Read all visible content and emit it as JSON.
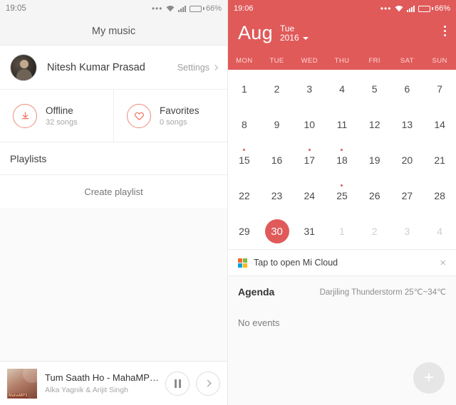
{
  "left": {
    "status": {
      "time": "19:05",
      "battery": "66%",
      "overflow_icon": "more-dots-icon",
      "wifi_icon": "wifi-icon",
      "signal_icon": "signal-icon"
    },
    "title": "My music",
    "profile": {
      "name": "Nitesh Kumar Prasad",
      "settings_label": "Settings",
      "avatar_name": "user-avatar"
    },
    "quick_items": [
      {
        "icon": "download-icon",
        "title": "Offline",
        "subtitle": "32 songs"
      },
      {
        "icon": "heart-icon",
        "title": "Favorites",
        "subtitle": "0 songs"
      }
    ],
    "playlists_header": "Playlists",
    "create_playlist": "Create playlist",
    "player": {
      "track_title": "Tum Saath Ho - MahaMP3...",
      "artist": "Alka Yagnik & Arijit Singh",
      "album_badge": "MahaMP3",
      "pause_label": "Pause",
      "next_label": "Next"
    }
  },
  "right": {
    "status": {
      "time": "19:06",
      "battery": "66%"
    },
    "header": {
      "month": "Aug",
      "weekday": "Tue",
      "year": "2016",
      "menu_label": "More options"
    },
    "weekdays": [
      "MON",
      "TUE",
      "WED",
      "THU",
      "FRI",
      "SAT",
      "SUN"
    ],
    "days": [
      {
        "n": "1"
      },
      {
        "n": "2"
      },
      {
        "n": "3"
      },
      {
        "n": "4"
      },
      {
        "n": "5"
      },
      {
        "n": "6"
      },
      {
        "n": "7"
      },
      {
        "n": "8"
      },
      {
        "n": "9"
      },
      {
        "n": "10"
      },
      {
        "n": "11"
      },
      {
        "n": "12"
      },
      {
        "n": "13"
      },
      {
        "n": "14"
      },
      {
        "n": "15",
        "dot": true
      },
      {
        "n": "16"
      },
      {
        "n": "17",
        "dot": true
      },
      {
        "n": "18",
        "dot": true
      },
      {
        "n": "19"
      },
      {
        "n": "20"
      },
      {
        "n": "21"
      },
      {
        "n": "22"
      },
      {
        "n": "23"
      },
      {
        "n": "24"
      },
      {
        "n": "25",
        "dot": true
      },
      {
        "n": "26"
      },
      {
        "n": "27"
      },
      {
        "n": "28"
      },
      {
        "n": "29"
      },
      {
        "n": "30",
        "selected": true
      },
      {
        "n": "31"
      },
      {
        "n": "1",
        "out": true
      },
      {
        "n": "2",
        "out": true
      },
      {
        "n": "3",
        "out": true
      },
      {
        "n": "4",
        "out": true
      }
    ],
    "micloud": {
      "text": "Tap to open Mi Cloud",
      "close": "×"
    },
    "agenda": {
      "title": "Agenda",
      "weather": "Darjiling  Thunderstorm  25℃~34℃",
      "empty": "No events"
    },
    "fab": "+"
  },
  "colors": {
    "accent_red": "#e05a5a",
    "accent_orange": "#f0705a"
  }
}
